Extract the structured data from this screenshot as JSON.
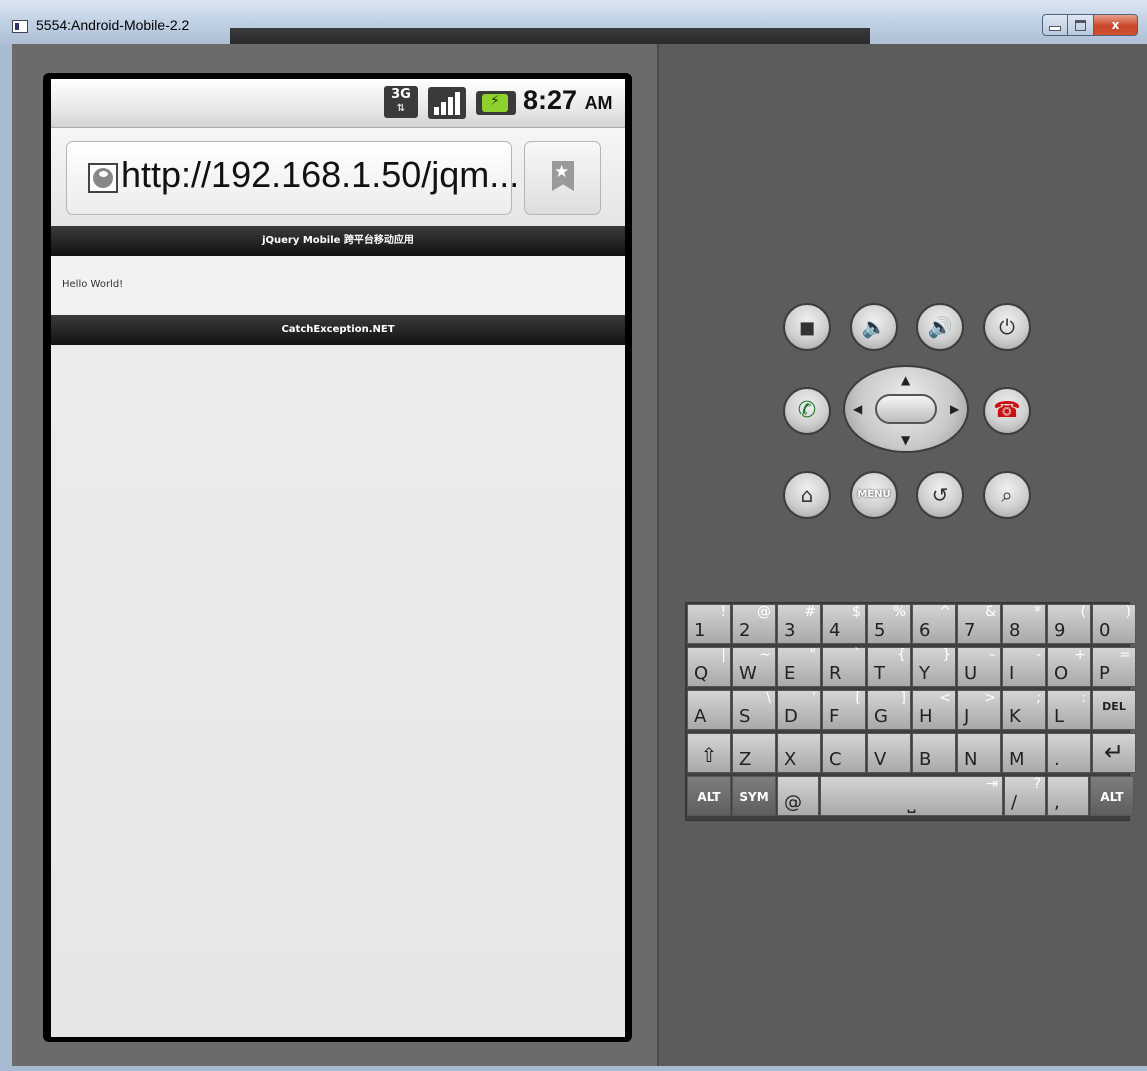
{
  "window": {
    "title": "5554:Android-Mobile-2.2",
    "controls": {
      "minimize": "",
      "maximize": "",
      "close": "x"
    }
  },
  "status_bar": {
    "network": "3G",
    "network_arrows": "⇅",
    "time": "8:27",
    "ampm": "AM",
    "battery_state": "charging"
  },
  "browser": {
    "url": "http://192.168.1.50/jqm...",
    "bookmark_icon": "bookmark-icon"
  },
  "page": {
    "header": "jQuery Mobile 跨平台移动应用",
    "content": "Hello World!",
    "footer": "CatchException.NET"
  },
  "controls": {
    "camera": "camera-icon",
    "volume_down": "volume-down-icon",
    "volume_up": "volume-up-icon",
    "power": "power-icon",
    "call": "call-icon",
    "end_call": "end-call-icon",
    "home": "home-icon",
    "menu": "MENU",
    "back": "back-icon",
    "search": "search-icon"
  },
  "keyboard": {
    "row1": [
      {
        "main": "1",
        "alt": "!"
      },
      {
        "main": "2",
        "alt": "@"
      },
      {
        "main": "3",
        "alt": "#"
      },
      {
        "main": "4",
        "alt": "$"
      },
      {
        "main": "5",
        "alt": "%"
      },
      {
        "main": "6",
        "alt": "^"
      },
      {
        "main": "7",
        "alt": "&"
      },
      {
        "main": "8",
        "alt": "*"
      },
      {
        "main": "9",
        "alt": "("
      },
      {
        "main": "0",
        "alt": ")"
      }
    ],
    "row2": [
      {
        "main": "Q",
        "alt": "|"
      },
      {
        "main": "W",
        "alt": "~"
      },
      {
        "main": "E",
        "alt": "\""
      },
      {
        "main": "R",
        "alt": "`"
      },
      {
        "main": "T",
        "alt": "{"
      },
      {
        "main": "Y",
        "alt": "}"
      },
      {
        "main": "U",
        "alt": "–"
      },
      {
        "main": "I",
        "alt": "-"
      },
      {
        "main": "O",
        "alt": "+"
      },
      {
        "main": "P",
        "alt": "="
      }
    ],
    "row3": [
      {
        "main": "A",
        "alt": ""
      },
      {
        "main": "S",
        "alt": "\\"
      },
      {
        "main": "D",
        "alt": "'"
      },
      {
        "main": "F",
        "alt": "["
      },
      {
        "main": "G",
        "alt": "]"
      },
      {
        "main": "H",
        "alt": "<"
      },
      {
        "main": "J",
        "alt": ">"
      },
      {
        "main": "K",
        "alt": ";"
      },
      {
        "main": "L",
        "alt": ":"
      }
    ],
    "del": "DEL",
    "row4": [
      {
        "main": "Z",
        "alt": ""
      },
      {
        "main": "X",
        "alt": ""
      },
      {
        "main": "C",
        "alt": ""
      },
      {
        "main": "V",
        "alt": ""
      },
      {
        "main": "B",
        "alt": ""
      },
      {
        "main": "N",
        "alt": ""
      },
      {
        "main": "M",
        "alt": ""
      },
      {
        "main": ".",
        "alt": ""
      }
    ],
    "alt": "ALT",
    "sym": "SYM",
    "at": "@",
    "slash": "/",
    "question": "?",
    "comma": ","
  }
}
